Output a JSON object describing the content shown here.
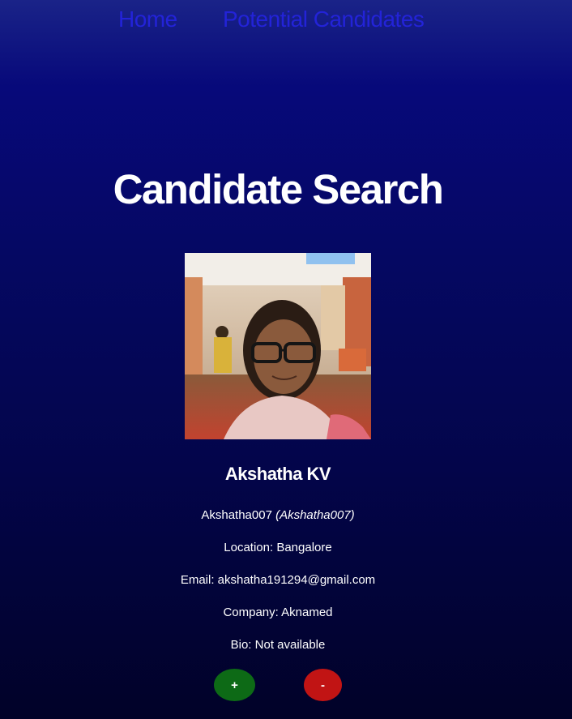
{
  "nav": {
    "home_label": "Home",
    "potential_label": "Potential Candidates"
  },
  "page": {
    "title": "Candidate Search"
  },
  "candidate": {
    "avatar_icon": "candidate-avatar-photo",
    "name": "Akshatha KV",
    "login": "Akshatha007",
    "login_italic": "(Akshatha007)",
    "location": "Location: Bangalore",
    "email": "Email: akshatha191294@gmail.com",
    "company": "Company: Aknamed",
    "bio": "Bio: Not available"
  },
  "actions": {
    "add_label": "+",
    "remove_label": "-"
  },
  "colors": {
    "nav_link": "#2323d8",
    "add_button": "#0d6a16",
    "remove_button": "#c11414",
    "background_top": "#1a2388",
    "background_bottom": "#010228"
  }
}
